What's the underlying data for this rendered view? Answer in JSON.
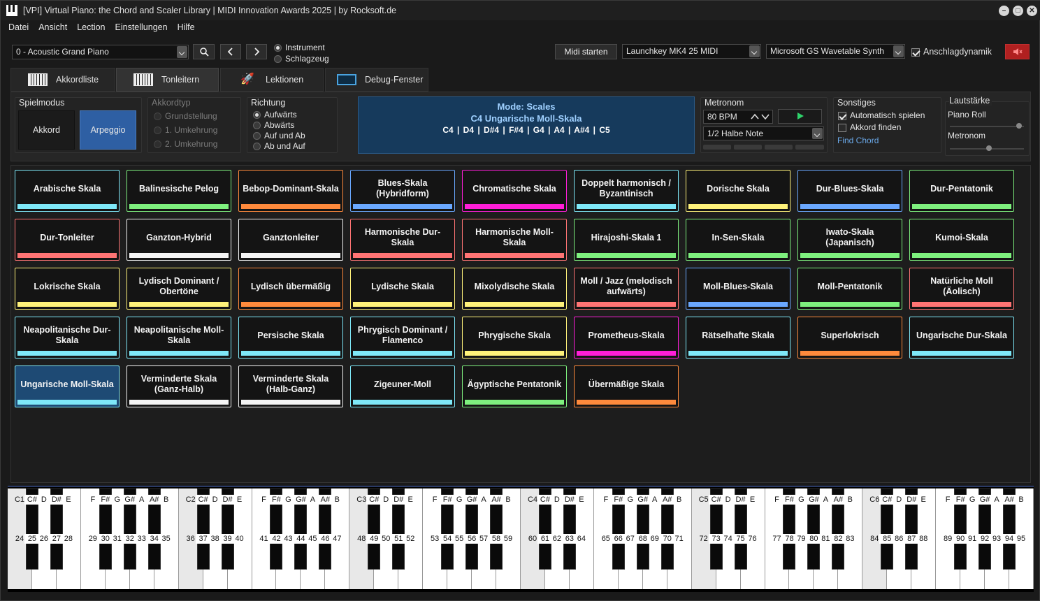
{
  "window": {
    "title": "[VPI] Virtual Piano: the Chord and Scaler Library | MIDI Innovation Awards 2025 | by Rocksoft.de"
  },
  "menu": [
    "Datei",
    "Ansicht",
    "Lection",
    "Einstellungen",
    "Hilfe"
  ],
  "toolbar": {
    "instrument": "0 - Acoustic Grand Piano",
    "mode_instrument": "Instrument",
    "mode_drums": "Schlagzeug",
    "midi_start": "Midi starten",
    "midi_in": "Launchkey MK4 25 MIDI",
    "midi_out": "Microsoft GS Wavetable Synth",
    "velocity": "Anschlagdynamik",
    "mute_color": "#b02020"
  },
  "tabs": [
    {
      "label": "Akkordliste",
      "icon": "piano-icon"
    },
    {
      "label": "Tonleitern",
      "icon": "piano-icon"
    },
    {
      "label": "Lektionen",
      "icon": "rocket-icon"
    },
    {
      "label": "Debug-Fenster",
      "icon": "monitor-icon"
    }
  ],
  "playmode": {
    "title": "Spielmodus",
    "chord": "Akkord",
    "arpeggio": "Arpeggio"
  },
  "chordtype": {
    "title": "Akkordtyp",
    "options": [
      "Grundstellung",
      "1. Umkehrung",
      "2. Umkehrung"
    ]
  },
  "direction": {
    "title": "Richtung",
    "options": [
      "Aufwärts",
      "Abwärts",
      "Auf und Ab",
      "Ab und Auf"
    ],
    "selected": 0
  },
  "modebox": {
    "line1": "Mode: Scales",
    "line2": "C4 Ungarische Moll-Skala",
    "line3": "C4 |  D4 |  D#4 |  F#4 |  G4 |  A4 |  A#4 |  C5"
  },
  "metronome": {
    "title": "Metronom",
    "bpm": "80 BPM",
    "note": "1/2 Halbe Note"
  },
  "misc": {
    "title": "Sonstiges",
    "autoplay": "Automatisch spielen",
    "findchord_chk": "Akkord finden",
    "findchord_link": "Find Chord"
  },
  "volume": {
    "title": "Lautstärke",
    "pianoroll": "Piano Roll",
    "metronome": "Metronom",
    "pianoroll_level": 0.97,
    "metronome_level": 0.55
  },
  "scales": [
    {
      "name": "Arabische Skala",
      "color": "#7ee8f8"
    },
    {
      "name": "Balinesische Pelog",
      "color": "#7ef07e"
    },
    {
      "name": "Bebop-Dominant-Skala",
      "color": "#ff8a3c"
    },
    {
      "name": "Blues-Skala (Hybridform)",
      "color": "#6aa8ff"
    },
    {
      "name": "Chromatische Skala",
      "color": "#ff1ed8"
    },
    {
      "name": "Doppelt harmonisch / Byzantinisch",
      "color": "#7ee8f8"
    },
    {
      "name": "Dorische Skala",
      "color": "#fff27a"
    },
    {
      "name": "Dur-Blues-Skala",
      "color": "#6aa8ff"
    },
    {
      "name": "Dur-Pentatonik",
      "color": "#7ef07e"
    },
    {
      "name": "Dur-Tonleiter",
      "color": "#ff7474"
    },
    {
      "name": "Ganzton-Hybrid",
      "color": "#f4f4f4"
    },
    {
      "name": "Ganztonleiter",
      "color": "#f4f4f4"
    },
    {
      "name": "Harmonische Dur-Skala",
      "color": "#ff7474"
    },
    {
      "name": "Harmonische Moll-Skala",
      "color": "#ff7474"
    },
    {
      "name": "Hirajoshi-Skala 1",
      "color": "#7ef07e"
    },
    {
      "name": "In-Sen-Skala",
      "color": "#7ef07e"
    },
    {
      "name": "Iwato-Skala (Japanisch)",
      "color": "#7ef07e"
    },
    {
      "name": "Kumoi-Skala",
      "color": "#7ef07e"
    },
    {
      "name": "Lokrische Skala",
      "color": "#fff27a"
    },
    {
      "name": "Lydisch Dominant / Obertöne",
      "color": "#fff27a"
    },
    {
      "name": "Lydisch übermäßig",
      "color": "#ff8a3c"
    },
    {
      "name": "Lydische Skala",
      "color": "#fff27a"
    },
    {
      "name": "Mixolydische Skala",
      "color": "#fff27a"
    },
    {
      "name": "Moll / Jazz (melodisch aufwärts)",
      "color": "#ff7474"
    },
    {
      "name": "Moll-Blues-Skala",
      "color": "#6aa8ff"
    },
    {
      "name": "Moll-Pentatonik",
      "color": "#7ef07e"
    },
    {
      "name": "Natürliche Moll (Äolisch)",
      "color": "#ff7474"
    },
    {
      "name": "Neapolitanische Dur-Skala",
      "color": "#7ee8f8"
    },
    {
      "name": "Neapolitanische Moll-Skala",
      "color": "#7ee8f8"
    },
    {
      "name": "Persische Skala",
      "color": "#7ee8f8"
    },
    {
      "name": "Phrygisch Dominant / Flamenco",
      "color": "#7ee8f8"
    },
    {
      "name": "Phrygische Skala",
      "color": "#fff27a"
    },
    {
      "name": "Prometheus-Skala",
      "color": "#ff1ed8"
    },
    {
      "name": "Rätselhafte Skala",
      "color": "#7ee8f8"
    },
    {
      "name": "Superlokrisch",
      "color": "#ff8a3c"
    },
    {
      "name": "Ungarische Dur-Skala",
      "color": "#7ee8f8"
    },
    {
      "name": "Ungarische Moll-Skala",
      "color": "#7ee8f8",
      "selected": true
    },
    {
      "name": "Verminderte Skala (Ganz-Halb)",
      "color": "#f4f4f4"
    },
    {
      "name": "Verminderte Skala (Halb-Ganz)",
      "color": "#f4f4f4"
    },
    {
      "name": "Zigeuner-Moll",
      "color": "#7ee8f8"
    },
    {
      "name": "Ägyptische Pentatonik",
      "color": "#7ef07e"
    },
    {
      "name": "Übermäßige Skala",
      "color": "#ff8a3c"
    }
  ],
  "keyboard": {
    "octaves": [
      "C1",
      "C2",
      "C3",
      "C4",
      "C5",
      "C6"
    ],
    "white_names": [
      "",
      "D",
      "E",
      "F",
      "G",
      "A",
      "B"
    ],
    "black_names": [
      "C#",
      "D#",
      "F#",
      "G#",
      "A#"
    ],
    "first_midi": 24,
    "last_midi": 95
  }
}
